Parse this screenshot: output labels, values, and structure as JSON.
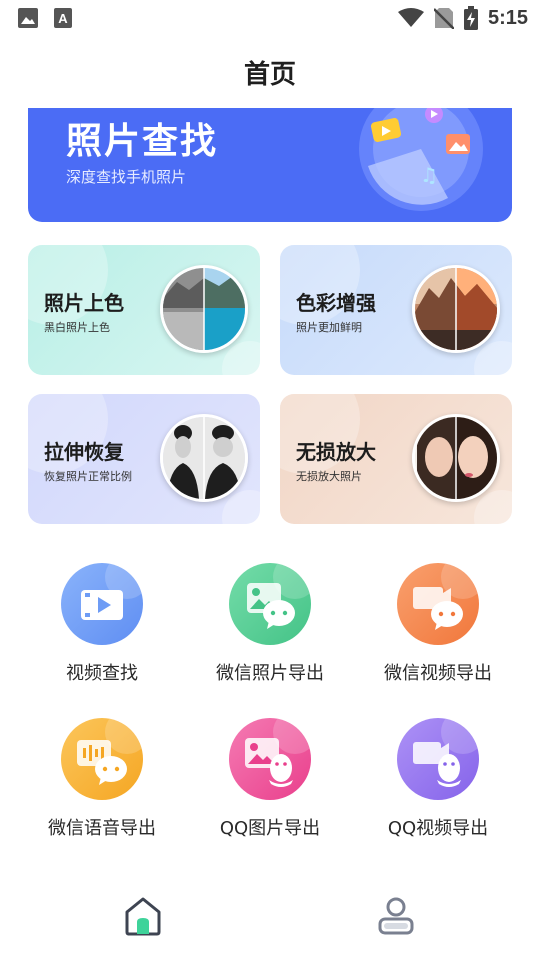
{
  "status_bar": {
    "time": "5:15",
    "icons": [
      "image-icon",
      "text-a-icon",
      "wifi-icon",
      "no-sim-icon",
      "battery-charging-icon"
    ]
  },
  "header": {
    "title": "首页"
  },
  "banner": {
    "title": "照片查找",
    "subtitle": "深度查找手机照片",
    "color": "#4b6cf5"
  },
  "features": [
    {
      "title": "照片上色",
      "subtitle": "黑白照片上色",
      "color": "#c8f1ea"
    },
    {
      "title": "色彩增强",
      "subtitle": "照片更加鲜明",
      "color": "#d0e1fb"
    },
    {
      "title": "拉伸恢复",
      "subtitle": "恢复照片正常比例",
      "color": "#d5dbfb"
    },
    {
      "title": "无损放大",
      "subtitle": "无损放大照片",
      "color": "#f3dccd"
    }
  ],
  "tools": [
    {
      "label": "视频查找",
      "icon": "video-icon",
      "color": "#6e9cf5"
    },
    {
      "label": "微信照片导出",
      "icon": "wechat-photo-icon",
      "color": "#56cf97"
    },
    {
      "label": "微信视频导出",
      "icon": "wechat-video-icon",
      "color": "#f5854e"
    },
    {
      "label": "微信语音导出",
      "icon": "wechat-voice-icon",
      "color": "#f9b33f"
    },
    {
      "label": "QQ图片导出",
      "icon": "qq-photo-icon",
      "color": "#f0549b"
    },
    {
      "label": "QQ视频导出",
      "icon": "qq-video-icon",
      "color": "#9777ee"
    }
  ],
  "bottom_nav": {
    "items": [
      {
        "icon": "home-icon",
        "active": true
      },
      {
        "icon": "profile-icon",
        "active": false
      }
    ],
    "accent": "#3ed39a"
  }
}
